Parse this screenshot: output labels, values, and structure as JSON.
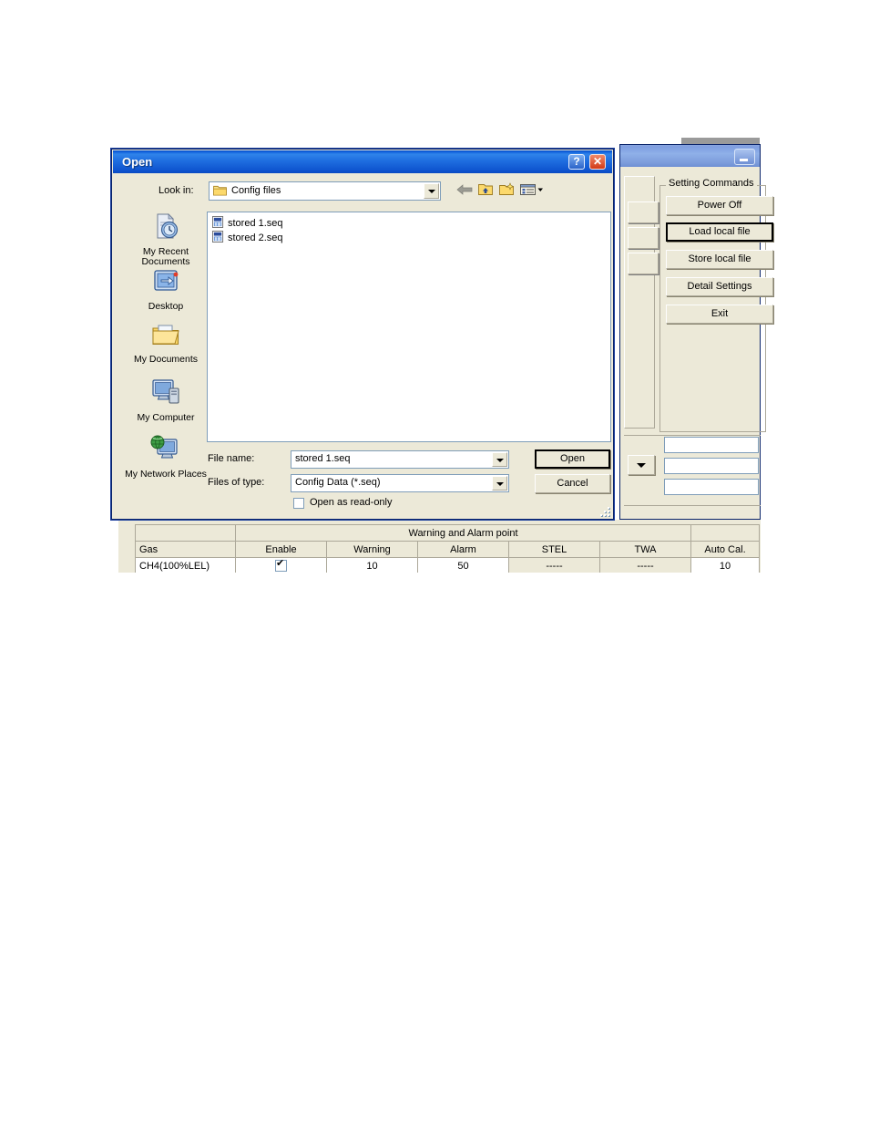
{
  "background_window": {
    "title": "",
    "minimize_label": "_",
    "setting_commands": {
      "legend": "Setting Commands",
      "buttons": [
        {
          "label": "Power Off",
          "focused": false
        },
        {
          "label": "Load local file",
          "focused": true
        },
        {
          "label": "Store local file",
          "focused": false
        },
        {
          "label": "Detail Settings",
          "focused": false
        },
        {
          "label": "Exit",
          "focused": false
        }
      ]
    }
  },
  "table": {
    "group_header": "Warning and Alarm point",
    "columns": [
      "Gas",
      "Enable",
      "Warning",
      "Alarm",
      "STEL",
      "TWA",
      "Auto Cal."
    ],
    "rows": [
      {
        "gas": "CH4(100%LEL)",
        "enable": true,
        "warning": "10",
        "alarm": "50",
        "stel": "-----",
        "twa": "-----",
        "auto_cal": "10"
      }
    ]
  },
  "dialog": {
    "title": "Open",
    "help_label": "?",
    "close_label": "✕",
    "lookin": {
      "label": "Look in:",
      "value": "Config files",
      "icon": "folder-icon"
    },
    "toolbar": [
      {
        "name": "back-icon",
        "label": "Back",
        "enabled": false
      },
      {
        "name": "up-one-level-icon",
        "label": "Up One Level",
        "enabled": true
      },
      {
        "name": "new-folder-icon",
        "label": "Create New Folder",
        "enabled": true
      },
      {
        "name": "views-icon",
        "label": "Views",
        "enabled": true
      }
    ],
    "places": [
      {
        "label": "My Recent Documents",
        "icon": "recent-documents-icon"
      },
      {
        "label": "Desktop",
        "icon": "desktop-icon"
      },
      {
        "label": "My Documents",
        "icon": "my-documents-icon"
      },
      {
        "label": "My Computer",
        "icon": "my-computer-icon"
      },
      {
        "label": "My Network Places",
        "icon": "network-places-icon"
      }
    ],
    "files": [
      {
        "name": "stored 1.seq",
        "icon": "seq-file-icon"
      },
      {
        "name": "stored 2.seq",
        "icon": "seq-file-icon"
      }
    ],
    "filename": {
      "label": "File name:",
      "value": "stored 1.seq"
    },
    "filetype": {
      "label": "Files of type:",
      "value": "Config Data (*.seq)"
    },
    "readonly": {
      "label": "Open as read-only",
      "checked": false
    },
    "buttons": {
      "open": "Open",
      "cancel": "Cancel"
    }
  },
  "colors": {
    "titlebar_blue": "#1f6ee0",
    "face": "#ece9d8",
    "border_blue": "#0a246a",
    "field_border": "#7f9db9",
    "close_red": "#d23a16"
  }
}
